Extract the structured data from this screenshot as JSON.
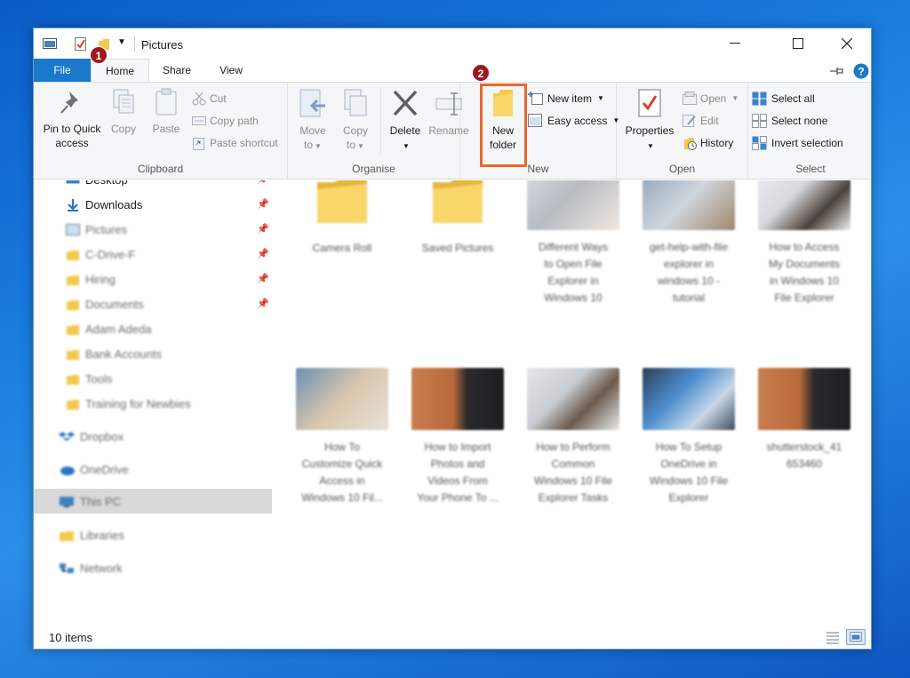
{
  "window": {
    "title": "Pictures"
  },
  "tabs": {
    "file": "File",
    "home": "Home",
    "share": "Share",
    "view": "View"
  },
  "badges": {
    "one": "1",
    "two": "2"
  },
  "ribbon": {
    "clipboard": {
      "pin_line1": "Pin to Quick",
      "pin_line2": "access",
      "copy": "Copy",
      "paste": "Paste",
      "cut": "Cut",
      "copy_path": "Copy path",
      "paste_shortcut": "Paste shortcut",
      "label": "Clipboard"
    },
    "organise": {
      "move_line1": "Move",
      "move_line2": "to",
      "copy_line1": "Copy",
      "copy_line2": "to",
      "delete": "Delete",
      "rename": "Rename",
      "label": "Organise"
    },
    "new": {
      "new_folder_line1": "New",
      "new_folder_line2": "folder",
      "new_item": "New item",
      "easy_access": "Easy access",
      "label": "New"
    },
    "open": {
      "properties": "Properties",
      "open": "Open",
      "edit": "Edit",
      "history": "History",
      "label": "Open"
    },
    "select": {
      "select_all": "Select all",
      "select_none": "Select none",
      "invert_selection": "Invert selection",
      "label": "Select"
    }
  },
  "nav": {
    "items": [
      {
        "label": "Desktop"
      },
      {
        "label": "Downloads"
      },
      {
        "label": "Pictures"
      },
      {
        "label": "C-Drive-F"
      },
      {
        "label": "Hiring"
      },
      {
        "label": "Documents"
      },
      {
        "label": "Adam Adeda"
      },
      {
        "label": "Bank Accounts"
      },
      {
        "label": "Tools"
      },
      {
        "label": "Training for Newbies"
      },
      {
        "label": "Dropbox"
      },
      {
        "label": "OneDrive"
      },
      {
        "label": "This PC"
      },
      {
        "label": "Libraries"
      },
      {
        "label": "Network"
      }
    ]
  },
  "files": [
    {
      "lines": [
        "Camera Roll"
      ]
    },
    {
      "lines": [
        "Saved Pictures"
      ]
    },
    {
      "lines": [
        "Different Ways",
        "to Open File",
        "Explorer in",
        "Windows 10"
      ]
    },
    {
      "lines": [
        "get-help-with-file",
        "explorer in",
        "windows 10 -",
        "tutorial"
      ]
    },
    {
      "lines": [
        "How to Access",
        "My Documents",
        "in Windows 10",
        "File Explorer"
      ]
    },
    {
      "lines": [
        "How To",
        "Customize Quick",
        "Access in",
        "Windows 10 Fil..."
      ]
    },
    {
      "lines": [
        "How to Import",
        "Photos and",
        "Videos From",
        "Your Phone To ..."
      ]
    },
    {
      "lines": [
        "How to Perform",
        "Common",
        "Windows 10 File",
        "Explorer Tasks"
      ]
    },
    {
      "lines": [
        "How To Setup",
        "OneDrive in",
        "Windows 10 File",
        "Explorer"
      ]
    },
    {
      "lines": [
        "shutterstock_41",
        "653460"
      ]
    }
  ],
  "status": {
    "count": "10 items"
  },
  "colors": {
    "accent": "#1979ca",
    "highlight": "#e8692d",
    "badge": "#a1171c",
    "folder": "#f2c94c"
  }
}
